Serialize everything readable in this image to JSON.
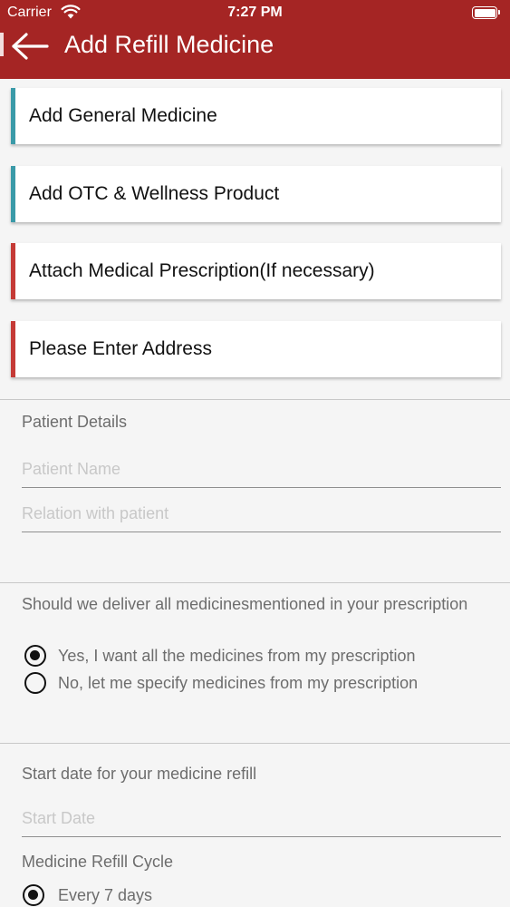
{
  "status_bar": {
    "carrier": "Carrier",
    "time": "7:27 PM",
    "wifi_icon": "wifi-icon",
    "battery_icon": "battery-icon"
  },
  "header": {
    "title": "Add Refill Medicine",
    "back_icon": "arrow-left-icon",
    "background": "#a52524"
  },
  "cards": [
    {
      "label": "Add General Medicine",
      "accent": "#3a9aa8"
    },
    {
      "label": "Add OTC & Wellness Product",
      "accent": "#3a9aa8"
    },
    {
      "label": "Attach Medical Prescription(If necessary)",
      "accent": "#c53a36"
    },
    {
      "label": "Please Enter Address",
      "accent": "#c53a36"
    }
  ],
  "patient": {
    "heading": "Patient Details",
    "name_placeholder": "Patient Name",
    "relation_placeholder": "Relation with patient"
  },
  "delivery": {
    "question": "Should we deliver all medicinesmentioned in your prescription",
    "options": [
      {
        "label": "Yes, I want all the medicines from my prescription",
        "selected": true
      },
      {
        "label": "No, let me specify medicines from my prescription",
        "selected": false
      }
    ]
  },
  "refill": {
    "start_heading": "Start date for your medicine refill",
    "start_placeholder": "Start Date",
    "cycle_heading": "Medicine Refill Cycle",
    "cycle_options": [
      {
        "label": "Every 7 days",
        "selected": true
      }
    ]
  }
}
